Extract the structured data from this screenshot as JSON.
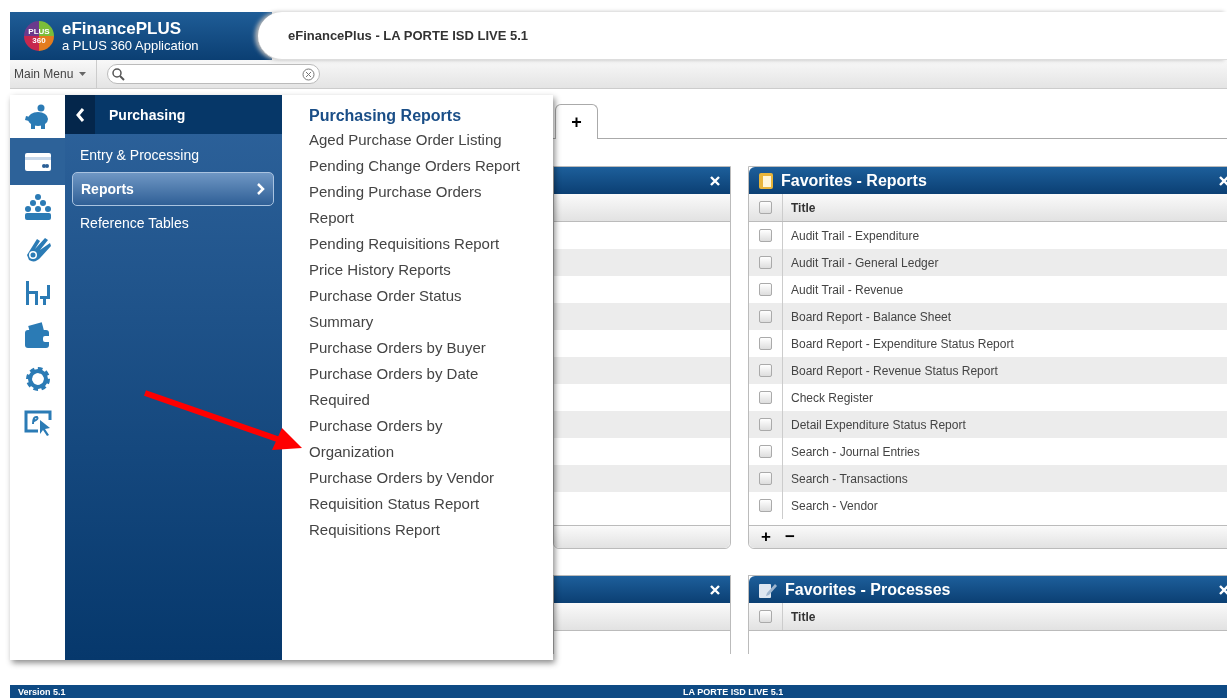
{
  "header": {
    "logo": [
      "PLUS",
      "360"
    ],
    "app_name": "eFinancePLUS",
    "tagline": "a PLUS 360 Application",
    "title": "eFinancePlus - LA PORTE ISD LIVE 5.1"
  },
  "toolbar": {
    "main_menu": "Main Menu"
  },
  "menu": {
    "modules": [
      {
        "selected": false
      },
      {
        "selected": true
      },
      {
        "selected": false
      },
      {
        "selected": false
      },
      {
        "selected": false
      },
      {
        "selected": false
      },
      {
        "selected": false
      },
      {
        "selected": false
      }
    ],
    "section": {
      "title": "Purchasing",
      "items": [
        {
          "label": "Entry & Processing",
          "selected": false
        },
        {
          "label": "Reports",
          "selected": true
        },
        {
          "label": "Reference Tables",
          "selected": false
        }
      ]
    },
    "submenu": {
      "title": "Purchasing Reports",
      "items": [
        "Aged Purchase Order Listing",
        "Pending Change Orders Report",
        "Pending Purchase Orders Report",
        "Pending Requisitions Report",
        "Price History Reports",
        "Purchase Order Status Summary",
        "Purchase Orders by Buyer",
        "Purchase Orders by Date Required",
        "Purchase Orders by Organization",
        "Purchase Orders by Vendor",
        "Requisition Status Report",
        "Requisitions Report"
      ]
    }
  },
  "tabs": [
    {
      "label": "+"
    }
  ],
  "favorites_reports": {
    "title": "Favorites - Reports",
    "column": "Title",
    "header_checked": false,
    "rows": [
      {
        "title": "Audit Trail - Expenditure",
        "checked": false
      },
      {
        "title": "Audit Trail - General Ledger",
        "checked": false
      },
      {
        "title": "Audit Trail - Revenue",
        "checked": false
      },
      {
        "title": "Board Report - Balance Sheet",
        "checked": false
      },
      {
        "title": "Board Report - Expenditure Status Report",
        "checked": false
      },
      {
        "title": "Board Report - Revenue Status Report",
        "checked": false
      },
      {
        "title": "Check Register",
        "checked": false
      },
      {
        "title": "Detail Expenditure Status Report",
        "checked": false
      },
      {
        "title": "Search - Journal Entries",
        "checked": false
      },
      {
        "title": "Search - Transactions",
        "checked": false
      },
      {
        "title": "Search - Vendor",
        "checked": false
      }
    ],
    "footer": [
      "+",
      "−"
    ]
  },
  "favorites_processes": {
    "title": "Favorites - Processes",
    "column": "Title",
    "header_checked": false
  },
  "status_bar": {
    "version": "Version 5.1",
    "environment": "LA PORTE ISD LIVE 5.1"
  }
}
